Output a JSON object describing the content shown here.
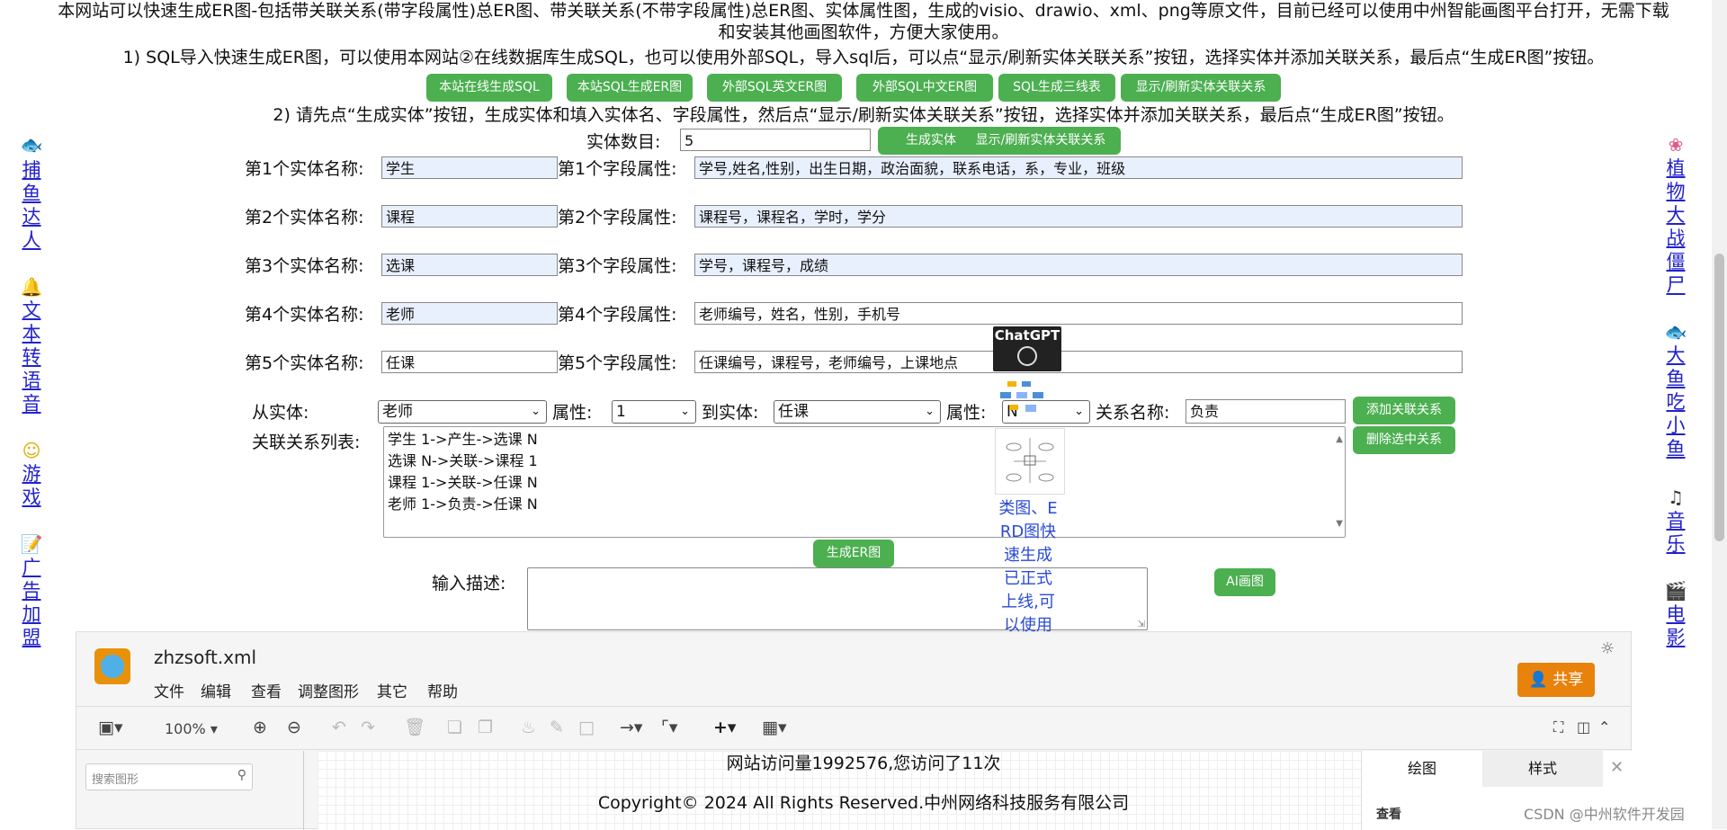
{
  "intro": {
    "line1": "本网站可以快速生成ER图-包括带关联关系(带字段属性)总ER图、带关联关系(不带字段属性)总ER图、实体属性图，生成的visio、drawio、xml、png等原文件，目前已经可以使用中州智能画图平台打开，无需下载",
    "line2": "和安装其他画图软件，方便大家使用。",
    "step1": "1) SQL导入快速生成ER图，可以使用本网站②在线数据库生成SQL，也可以使用外部SQL，导入sql后，可以点“显示/刷新实体关联关系”按钮，选择实体并添加关联关系，最后点“生成ER图”按钮。",
    "step2": "2) 请先点“生成实体”按钮，生成实体和填入实体名、字段属性，然后点“显示/刷新实体关联关系”按钮，选择实体并添加关联关系，最后点“生成ER图”按钮。"
  },
  "sql_buttons": [
    "本站在线生成SQL",
    "本站SQL生成ER图",
    "外部SQL英文ER图",
    "外部SQL中文ER图",
    "SQL生成三线表",
    "显示/刷新实体关联关系"
  ],
  "entity_count": {
    "label": "实体数目:",
    "value": "5",
    "generate_btn": "生成实体",
    "refresh_btn": "显示/刷新实体关联关系"
  },
  "entities": [
    {
      "name_label": "第1个实体名称:",
      "name": "学生",
      "field_label": "第1个字段属性:",
      "fields": "学号,姓名,性别，出生日期，政治面貌，联系电话，系，专业，班级"
    },
    {
      "name_label": "第2个实体名称:",
      "name": "课程",
      "field_label": "第2个字段属性:",
      "fields": "课程号，课程名，学时，学分"
    },
    {
      "name_label": "第3个实体名称:",
      "name": "选课",
      "field_label": "第3个字段属性:",
      "fields": "学号，课程号，成绩"
    },
    {
      "name_label": "第4个实体名称:",
      "name": "老师",
      "field_label": "第4个字段属性:",
      "fields": "老师编号，姓名，性别，手机号"
    },
    {
      "name_label": "第5个实体名称:",
      "name": "任课",
      "field_label": "第5个字段属性:",
      "fields": "任课编号，课程号，老师编号，上课地点"
    }
  ],
  "relation": {
    "from_label": "从实体:",
    "from_value": "老师",
    "attr_label": "属性:",
    "attr1_value": "1",
    "to_label": "到实体:",
    "to_value": "任课",
    "attr2_label": "属性:",
    "attr2_value": "N",
    "name_label": "关系名称:",
    "name_value": "负责",
    "add_btn": "添加关联关系",
    "delete_btn": "删除选中关系",
    "list_label": "关联关系列表:",
    "list": [
      "学生 1->产生->选课 N",
      "选课 N->关联->课程 1",
      "课程 1->关联->任课 N",
      "老师 1->负责->任课 N"
    ]
  },
  "generate_er_btn": "生成ER图",
  "ai": {
    "label": "输入描述:",
    "btn": "AI画图"
  },
  "promo": {
    "chatgpt_text": "ChatGPT",
    "text": "类图、ERD图快速生成已正式上线,可以使用"
  },
  "left_sidebar": [
    "捕鱼达人",
    "文本转语音",
    "游戏",
    "广告加盟"
  ],
  "right_sidebar": [
    "植物大战僵尸",
    "大鱼吃小鱼",
    "音乐",
    "电影"
  ],
  "editor": {
    "title": "zhzsoft.xml",
    "menu": [
      "文件",
      "编辑",
      "查看",
      "调整图形",
      "其它",
      "帮助"
    ],
    "share_btn": "共享",
    "zoom": "100%",
    "search_placeholder": "搜索图形",
    "tabs": [
      "绘图",
      "样式"
    ],
    "panel_heading": "查看"
  },
  "footer": {
    "visits": "网站访问量1992576,您访问了11次",
    "copyright": "Copyright© 2024 All Rights Reserved.中州网络科技服务有限公司",
    "watermark": "CSDN @中州软件开发园"
  },
  "colors": {
    "green": "#4caf50",
    "link": "#2222cc",
    "share": "#e8820c"
  }
}
